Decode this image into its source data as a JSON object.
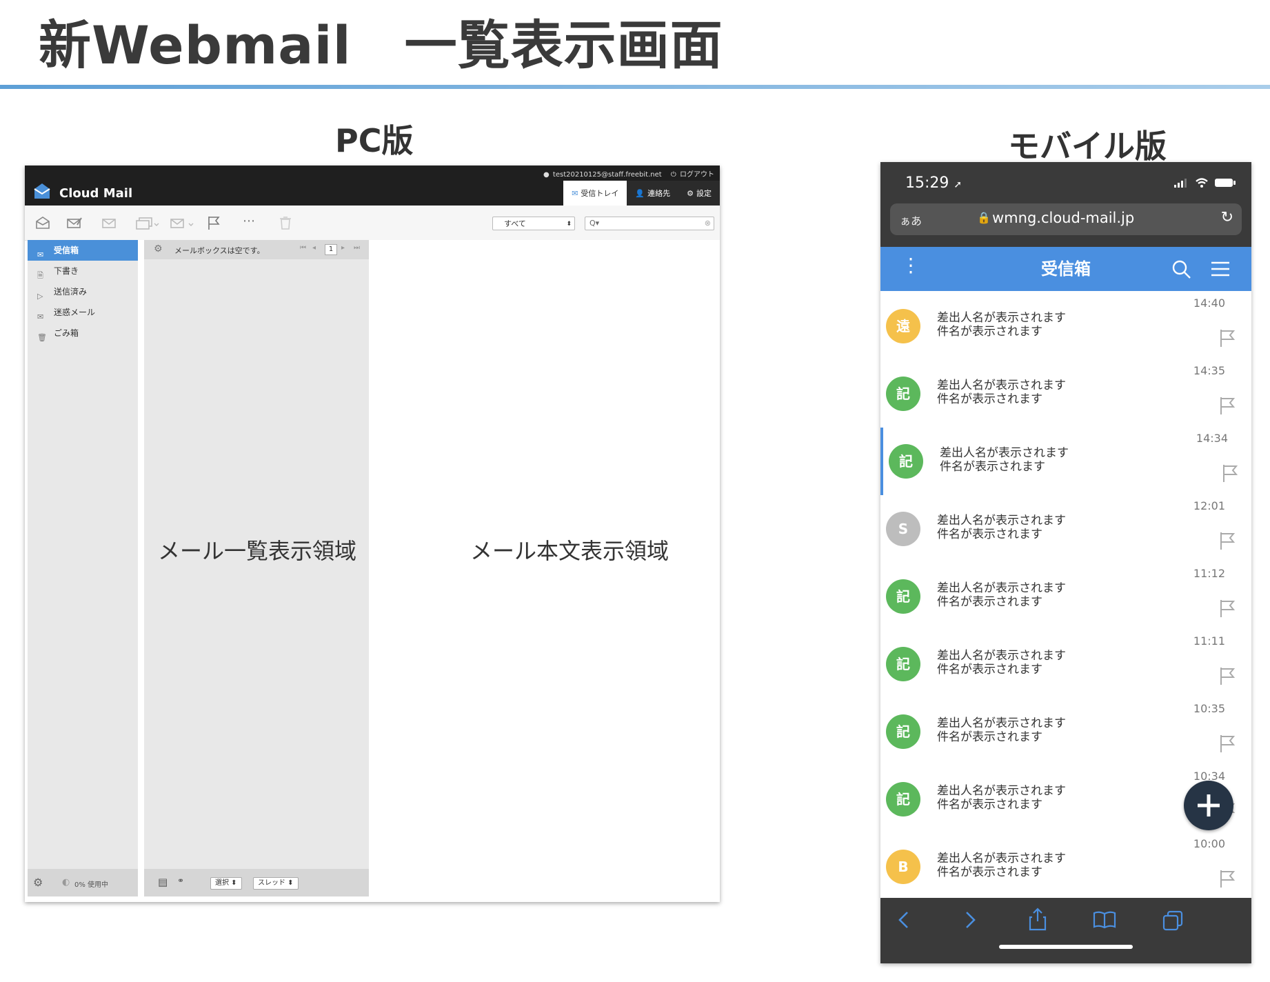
{
  "slide": {
    "title": "新Webmail　一覧表示画面",
    "pc_label": "PC版",
    "mobile_label": "モバイル版"
  },
  "pc": {
    "user_email": "test20210125@staff.freebit.net",
    "logout_label": "ログアウト",
    "brand": "Cloud Mail",
    "tabs": [
      {
        "label": "受信トレイ",
        "icon": "envelope-icon"
      },
      {
        "label": "連絡先",
        "icon": "person-icon"
      },
      {
        "label": "設定",
        "icon": "gear-icon"
      }
    ],
    "filter_value": "すべて",
    "search_placeholder": "Q▾",
    "folders": [
      {
        "label": "受信箱",
        "icon": "inbox-icon",
        "active": true
      },
      {
        "label": "下書き",
        "icon": "draft-icon"
      },
      {
        "label": "送信済み",
        "icon": "sent-icon"
      },
      {
        "label": "迷惑メール",
        "icon": "spam-icon"
      },
      {
        "label": "ごみ箱",
        "icon": "trash-icon"
      }
    ],
    "quota": "0% 使用中",
    "list_empty_message": "メールボックスは空です。",
    "page_number": "1",
    "list_area_label": "メール一覧表示領域",
    "body_area_label": "メール本文表示領域",
    "select_label": "選択",
    "thread_label": "スレッド"
  },
  "mobile": {
    "status_time": "15:29",
    "address_aa": "ぁあ",
    "url": "wmng.cloud-mail.jp",
    "header_title": "受信箱",
    "rows": [
      {
        "avatar": "遠",
        "color": "#f5c14b",
        "sender": "差出人名が表示されます",
        "subject": "件名が表示されます",
        "time": "14:40"
      },
      {
        "avatar": "記",
        "color": "#5cb85c",
        "sender": "差出人名が表示されます",
        "subject": "件名が表示されます",
        "time": "14:35"
      },
      {
        "avatar": "記",
        "color": "#5cb85c",
        "sender": "差出人名が表示されます",
        "subject": "件名が表示されます",
        "time": "14:34",
        "selected": true
      },
      {
        "avatar": "S",
        "color": "#bdbdbd",
        "sender": "差出人名が表示されます",
        "subject": "件名が表示されます",
        "time": "12:01"
      },
      {
        "avatar": "記",
        "color": "#5cb85c",
        "sender": "差出人名が表示されます",
        "subject": "件名が表示されます",
        "time": "11:12"
      },
      {
        "avatar": "記",
        "color": "#5cb85c",
        "sender": "差出人名が表示されます",
        "subject": "件名が表示されます",
        "time": "11:11"
      },
      {
        "avatar": "記",
        "color": "#5cb85c",
        "sender": "差出人名が表示されます",
        "subject": "件名が表示されます",
        "time": "10:35"
      },
      {
        "avatar": "記",
        "color": "#5cb85c",
        "sender": "差出人名が表示されます",
        "subject": "件名が表示されます",
        "time": "10:34"
      },
      {
        "avatar": "B",
        "color": "#f5c14b",
        "sender": "差出人名が表示されます",
        "subject": "件名が表示されます",
        "time": "10:00"
      }
    ]
  }
}
